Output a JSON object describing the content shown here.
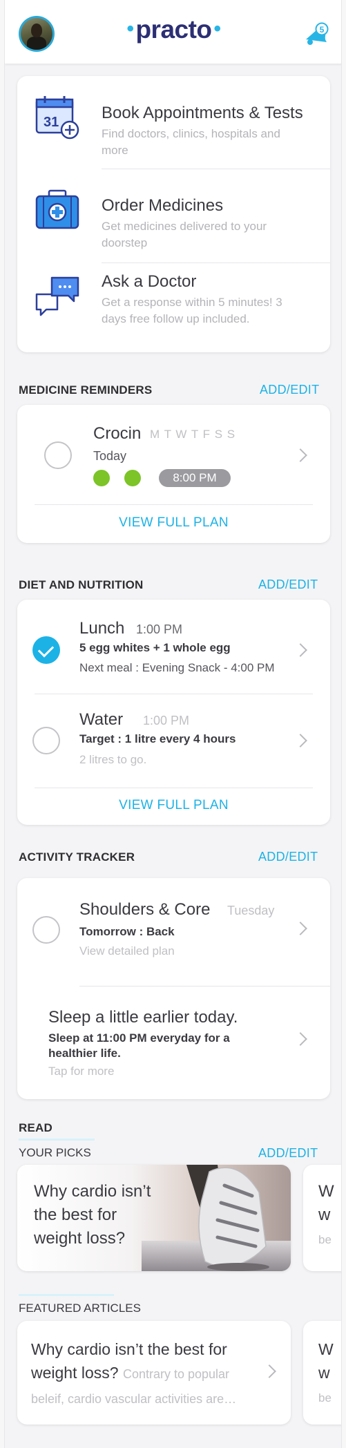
{
  "header": {
    "logo": "practo",
    "notification_count": "5"
  },
  "services": [
    {
      "title": "Book Appointments & Tests",
      "desc": "Find doctors, clinics, hospitals and more",
      "icon": "calendar-plus-icon"
    },
    {
      "title": "Order Medicines",
      "desc": "Get medicines delivered to your doorstep",
      "icon": "medicine-box-icon"
    },
    {
      "title": "Ask a Doctor",
      "desc": "Get a response within 5 minutes! 3 days free follow up included.",
      "icon": "chat-bubbles-icon"
    }
  ],
  "medicine_reminders": {
    "title": "MEDICINE REMINDERS",
    "add_edit": "ADD/EDIT",
    "name": "Crocin",
    "days": "M T W T F S S",
    "when": "Today",
    "time": "8:00 PM",
    "view_plan": "VIEW FULL PLAN"
  },
  "diet": {
    "title": "DIET AND NUTRITION",
    "add_edit": "ADD/EDIT",
    "lunch": {
      "name": "Lunch",
      "time": "1:00 PM",
      "detail": "5 egg whites + 1 whole egg",
      "next": "Next meal : Evening Snack - 4:00 PM"
    },
    "water": {
      "name": "Water",
      "time": "1:00 PM",
      "detail": "Target : 1 litre every 4 hours",
      "remaining": "2 litres to go."
    },
    "view_plan": "VIEW FULL PLAN"
  },
  "activity": {
    "title": "ACTIVITY TRACKER",
    "add_edit": "ADD/EDIT",
    "workout": {
      "name": "Shoulders & Core",
      "day": "Tuesday",
      "tomorrow": "Tomorrow : Back",
      "link": "View detailed plan"
    },
    "sleep": {
      "title": "Sleep a little earlier today.",
      "detail_line1": "Sleep at 11:00 PM everyday for a",
      "detail_line2": "healthier life.",
      "link": "Tap for more"
    }
  },
  "read": {
    "title": "READ",
    "picks_title": "YOUR PICKS",
    "add_edit": "ADD/EDIT",
    "pick_text": "Why cardio isn’t the best for weight loss?",
    "pick2_peek": "W w be",
    "featured_title": "FEATURED ARTICLES",
    "article_title": "Why cardio isn’t the best for weight loss?",
    "article_teaser": "Contrary to popular beleif, cardio vascular activities are…"
  }
}
